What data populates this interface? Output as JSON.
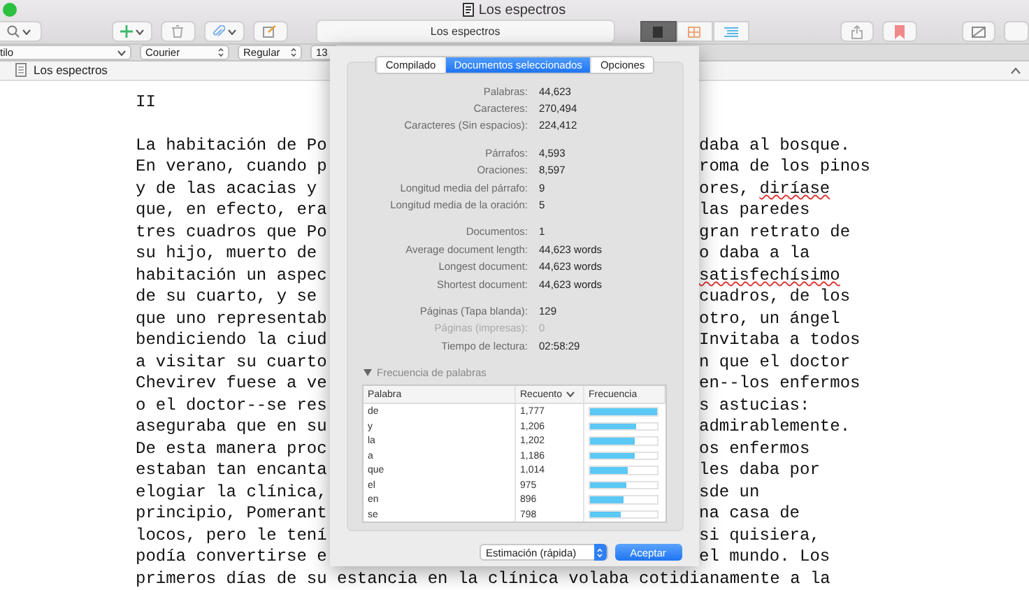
{
  "window": {
    "title": "Los espectros"
  },
  "toolbar": {
    "document_field": "Los espectros",
    "view_modes": [
      {
        "selected": true
      },
      {
        "selected": false
      },
      {
        "selected": false
      }
    ]
  },
  "format_bar": {
    "style": "tilo",
    "font": "Courier",
    "weight": "Regular",
    "size": "13"
  },
  "header": {
    "title": "Los espectros"
  },
  "editor": {
    "heading": "II",
    "lines": [
      {
        "left": "La habitación de Po",
        "right": "daba al bosque.",
        "misspelled": false
      },
      {
        "left": "En verano, cuando p",
        "right": "roma de los pinos",
        "misspelled": false
      },
      {
        "left": "y de las acacias y",
        "right": "ores, diríase",
        "misspelled": true
      },
      {
        "left": "que, en efecto, era",
        "right": "las paredes",
        "misspelled": false
      },
      {
        "left": "tres cuadros que Po",
        "right": "gran retrato de",
        "misspelled": false
      },
      {
        "left": "su hijo, muerto de",
        "right": "o daba a la",
        "misspelled": false
      },
      {
        "left": "habitación un aspec",
        "right": "satisfechísimo",
        "misspelled": true
      },
      {
        "left": "de su cuarto, y se",
        "right": "cuadros, de los",
        "misspelled": false
      },
      {
        "left": "que uno representab",
        "right": "otro, un ángel",
        "misspelled": false
      },
      {
        "left": "bendiciendo la ciud",
        "right": "Invitaba a todos",
        "misspelled": false
      },
      {
        "left": "a visitar su cuarto",
        "right": "n que el doctor",
        "misspelled": false
      },
      {
        "left": "Chevirev fuese a ve",
        "right": "en--los enfermos",
        "misspelled": false
      },
      {
        "left": "o el doctor--se res",
        "right": "s astucias:",
        "misspelled": false
      },
      {
        "left": "aseguraba que en su",
        "right": "admirablemente.",
        "misspelled": false
      },
      {
        "left": "De esta manera proc",
        "right": "os enfermos",
        "misspelled": false
      },
      {
        "left": "estaban tan encanta",
        "right": "les daba por",
        "misspelled": false
      },
      {
        "left": "elogiar la clínica,",
        "right": "sde un",
        "misspelled": false
      },
      {
        "left": "principio, Pomerant",
        "right": "na casa de",
        "misspelled": false
      },
      {
        "left": "locos, pero le tení",
        "right": "si quisiera,",
        "misspelled": false
      },
      {
        "left": "podía convertirse e",
        "right": "el mundo. Los",
        "misspelled": false
      }
    ],
    "last_line": "primeros días de su estancia en la clínica volaba cotidianamente a la"
  },
  "dialog": {
    "tabs": [
      {
        "label": "Compilado",
        "selected": false
      },
      {
        "label": "Documentos seleccionados",
        "selected": true
      },
      {
        "label": "Opciones",
        "selected": false
      }
    ],
    "stat_groups": [
      [
        {
          "label": "Palabras:",
          "value": "44,623",
          "disabled": false
        },
        {
          "label": "Caracteres:",
          "value": "270,494",
          "disabled": false
        },
        {
          "label": "Caracteres (Sin espacios):",
          "value": "224,412",
          "disabled": false
        }
      ],
      [
        {
          "label": "Párrafos:",
          "value": "4,593",
          "disabled": false
        },
        {
          "label": "Oraciones:",
          "value": "8,597",
          "disabled": false
        },
        {
          "label": "Longitud media del párrafo:",
          "value": "9",
          "disabled": false
        },
        {
          "label": "Longitud media de la oración:",
          "value": "5",
          "disabled": false
        }
      ],
      [
        {
          "label": "Documentos:",
          "value": "1",
          "disabled": false
        },
        {
          "label": "Average document length:",
          "value": "44,623 words",
          "disabled": false
        },
        {
          "label": "Longest document:",
          "value": "44,623 words",
          "disabled": false
        },
        {
          "label": "Shortest document:",
          "value": "44,623 words",
          "disabled": false
        }
      ],
      [
        {
          "label": "Páginas (Tapa blanda):",
          "value": "129",
          "disabled": false
        },
        {
          "label": "Páginas (impresas):",
          "value": "0",
          "disabled": true
        },
        {
          "label": "Tiempo de lectura:",
          "value": "02:58:29",
          "disabled": false
        }
      ]
    ],
    "frequency": {
      "title": "Frecuencia de palabras",
      "expanded": true,
      "columns": [
        "Palabra",
        "Recuento",
        "Frecuencia"
      ],
      "rows": [
        {
          "word": "de",
          "count": "1,777",
          "level": 1.0
        },
        {
          "word": "y",
          "count": "1,206",
          "level": 0.68
        },
        {
          "word": "la",
          "count": "1,202",
          "level": 0.67
        },
        {
          "word": "a",
          "count": "1,186",
          "level": 0.67
        },
        {
          "word": "que",
          "count": "1,014",
          "level": 0.56
        },
        {
          "word": "el",
          "count": "975",
          "level": 0.55
        },
        {
          "word": "en",
          "count": "896",
          "level": 0.5
        },
        {
          "word": "se",
          "count": "798",
          "level": 0.45
        }
      ]
    },
    "estimate": "Estimación (rápida)",
    "accept": "Aceptar"
  }
}
